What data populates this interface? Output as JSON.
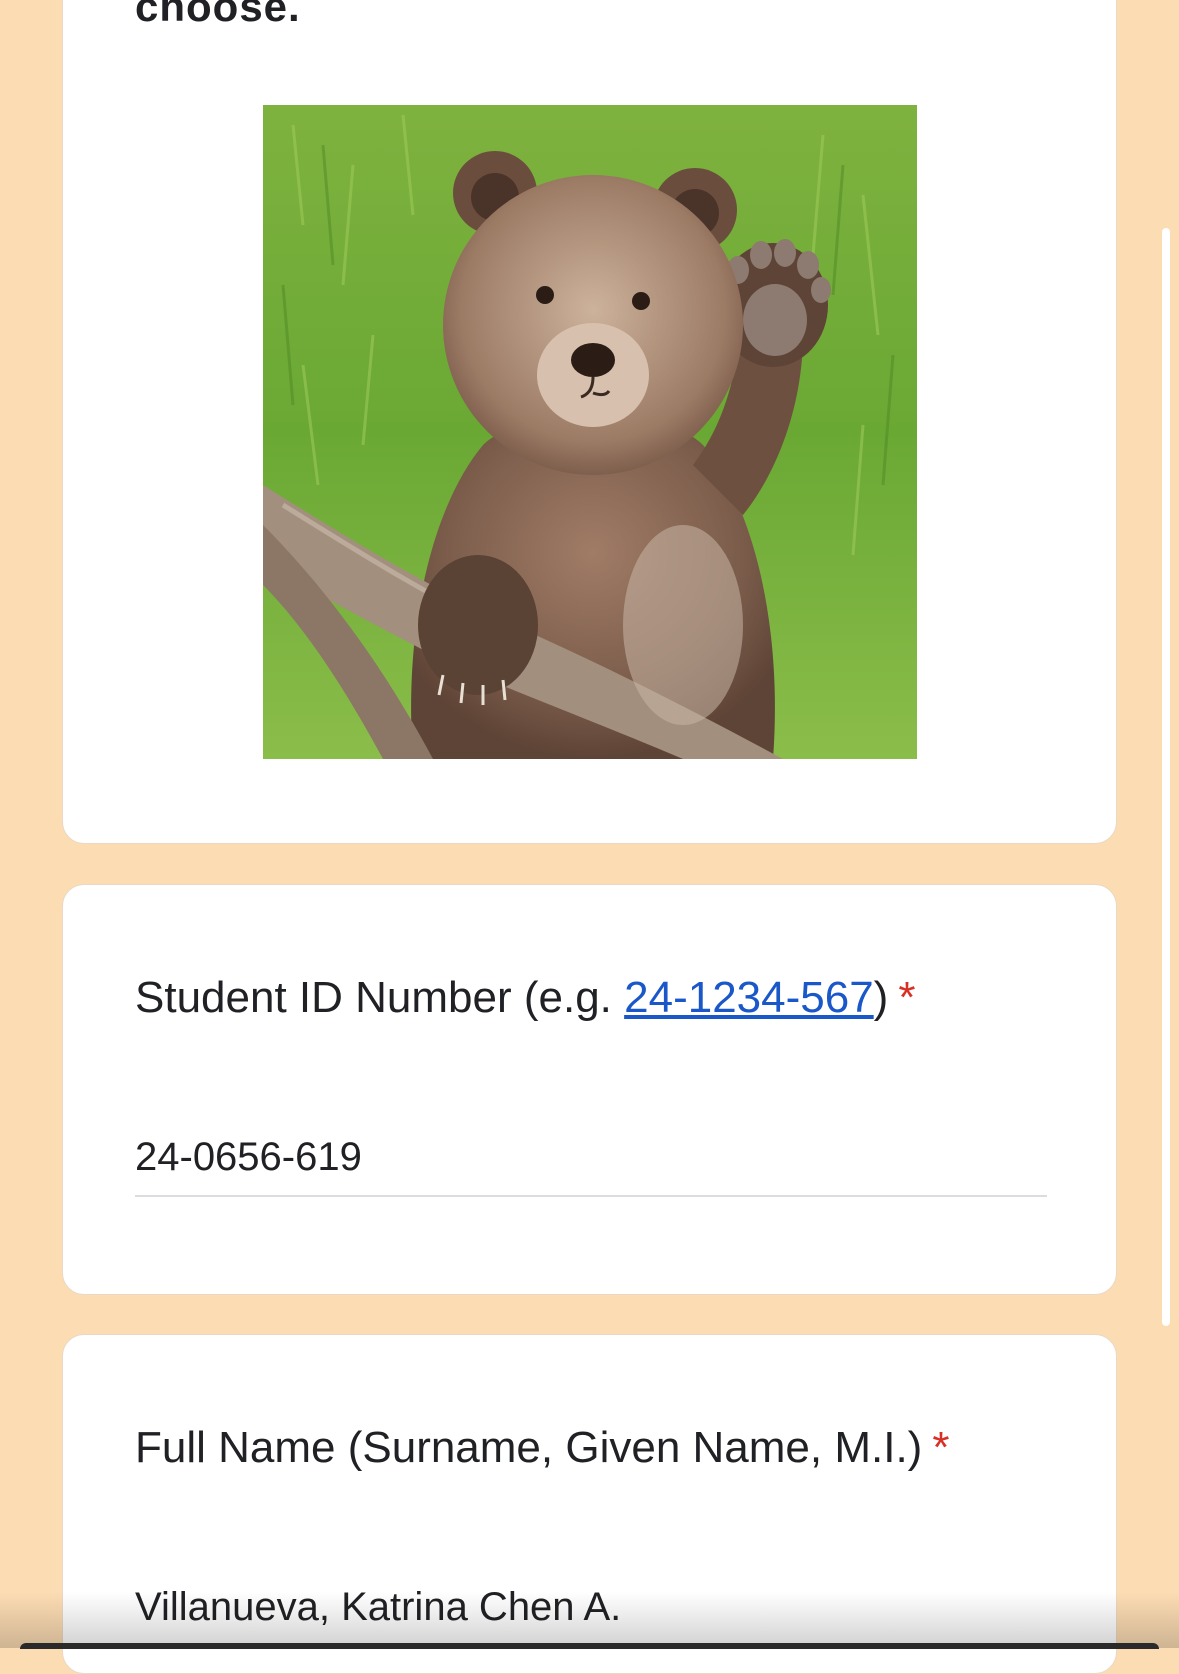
{
  "form": {
    "cut_title": "choose.",
    "image_alt": "brown bear cub waving",
    "questions": [
      {
        "label_prefix": "Student ID Number (e.g. ",
        "label_link": "24-1234-567",
        "label_suffix": ")",
        "required_mark": "*",
        "answer": "24-0656-619"
      },
      {
        "label": "Full Name (Surname, Given Name, M.I.)",
        "required_mark": "*",
        "answer": "Villanueva, Katrina Chen A."
      }
    ]
  },
  "colors": {
    "background": "#fcdcb3",
    "card": "#ffffff",
    "required": "#d93025",
    "link": "#1a57c8"
  }
}
